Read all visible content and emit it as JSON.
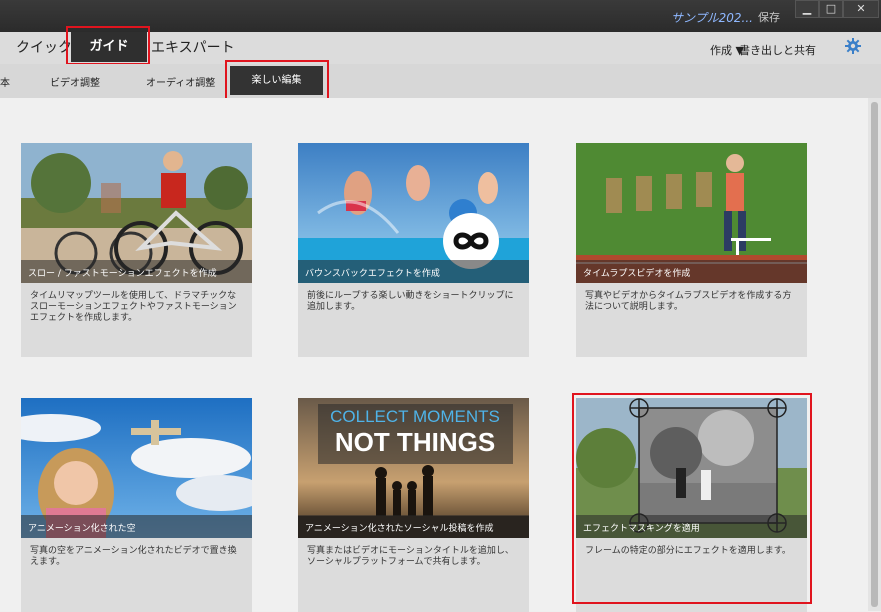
{
  "titlebar": {
    "project_name": "サンプル202...",
    "save_label": "保存",
    "minimize": "▁",
    "maximize": "□",
    "close": "✕"
  },
  "modebar": {
    "quick": "クイック",
    "guide": "ガイド",
    "expert": "エキスパート",
    "create": "作成 ▼",
    "export": "書き出しと共有"
  },
  "subtabs": {
    "edge": "本",
    "video_adjust": "ビデオ調整",
    "audio_adjust": "オーディオ調整",
    "fun_edit": "楽しい編集"
  },
  "cards": [
    {
      "title": "スロー / ファストモーションエフェクトを作成",
      "desc": "タイムリマップツールを使用して、ドラマチックなスローモーションエフェクトやファストモーションエフェクトを作成します。"
    },
    {
      "title": "バウンスバックエフェクトを作成",
      "desc": "前後にループする楽しい動きをショートクリップに追加します。"
    },
    {
      "title": "タイムラプスビデオを作成",
      "desc": "写真やビデオからタイムラプスビデオを作成する方法について説明します。"
    },
    {
      "title": "アニメーション化された空",
      "desc": "写真の空をアニメーション化されたビデオで置き換えます。"
    },
    {
      "title": "アニメーション化されたソーシャル投稿を作成",
      "desc": "写真またはビデオにモーションタイトルを追加し、ソーシャルプラットフォームで共有します。",
      "thumb_line1": "COLLECT MOMENTS",
      "thumb_line2": "NOT THINGS"
    },
    {
      "title": "エフェクトマスキングを適用",
      "desc": "フレームの特定の部分にエフェクトを適用します。"
    }
  ]
}
